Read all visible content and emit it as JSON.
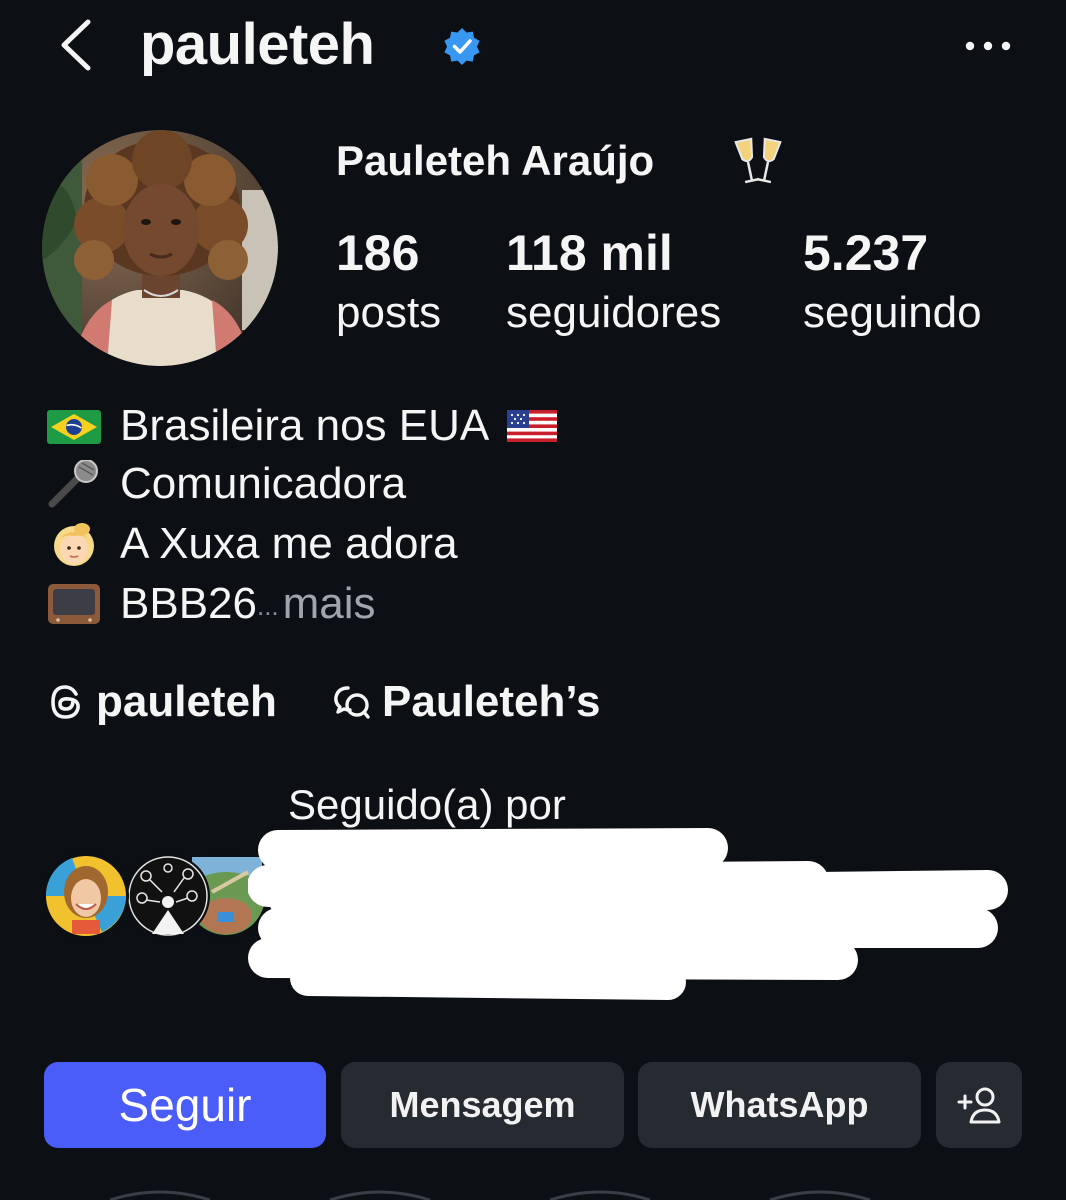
{
  "header": {
    "username": "pauleteh",
    "verified": true,
    "accent_color": "#3897f0"
  },
  "profile": {
    "full_name": "Pauleteh Araújo",
    "name_emoji": "champagne-glasses-icon",
    "stats": [
      {
        "value": "186",
        "label": "posts"
      },
      {
        "value": "118 mil",
        "label": "seguidores"
      },
      {
        "value": "5.237",
        "label": "seguindo"
      }
    ]
  },
  "bio": {
    "lines": [
      {
        "icon": "brazil-flag-icon",
        "text": "Brasileira nos EUA",
        "trailing_icon": "usa-flag-icon"
      },
      {
        "icon": "microphone-icon",
        "text": "Comunicadora"
      },
      {
        "icon": "blonde-person-icon",
        "text": "A Xuxa me adora"
      },
      {
        "icon": "television-icon",
        "text": "BBB26"
      }
    ],
    "ellipsis": "...",
    "more_label": "mais"
  },
  "links": {
    "threads": {
      "icon": "threads-icon",
      "label": "pauleteh"
    },
    "channel": {
      "icon": "broadcast-channel-icon",
      "label": "Pauleteh’s"
    }
  },
  "followed_by": {
    "label": "Seguido(a) por",
    "redacted": true
  },
  "actions": {
    "follow": "Seguir",
    "message": "Mensagem",
    "whatsapp": "WhatsApp",
    "suggest_icon": "add-person-icon"
  },
  "colors": {
    "background": "#0c0f14",
    "follow_button": "#4a5df9",
    "secondary_button": "#262a31",
    "muted_text": "#a0a4ab"
  }
}
